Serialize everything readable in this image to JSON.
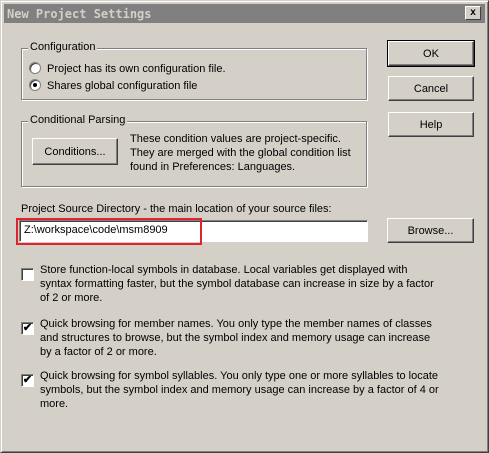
{
  "window": {
    "title": "New Project Settings",
    "close_glyph": "x"
  },
  "configuration": {
    "legend": "Configuration",
    "options": [
      {
        "label": "Project has its own configuration file.",
        "selected": false
      },
      {
        "label": "Shares global configuration file",
        "selected": true
      }
    ]
  },
  "conditional_parsing": {
    "legend": "Conditional Parsing",
    "button_label": "Conditions...",
    "description": "These condition values are project-specific. They are merged with the global condition list found in Preferences: Languages."
  },
  "buttons": {
    "ok": "OK",
    "cancel": "Cancel",
    "help": "Help",
    "browse": "Browse..."
  },
  "source_directory": {
    "label": "Project Source Directory - the main location of your source files:",
    "value": "Z:\\workspace\\code\\msm8909",
    "highlight_color": "#e0232b"
  },
  "options": [
    {
      "checked": false,
      "text": "Store function-local symbols in database.  Local variables get displayed with syntax formatting faster, but the symbol database can increase in size by a factor of 2 or more."
    },
    {
      "checked": true,
      "text": "Quick browsing for member names.  You only type the member names of classes and structures to browse, but the symbol index and memory usage can increase by a factor of 2 or more."
    },
    {
      "checked": true,
      "text": "Quick browsing for symbol syllables.  You only type one or more syllables to locate symbols, but the symbol index and memory usage can increase by a factor of 4 or more."
    }
  ],
  "check_glyph": "✔",
  "colors": {
    "face": "#d4d0c8",
    "titlebar": "#808080"
  }
}
